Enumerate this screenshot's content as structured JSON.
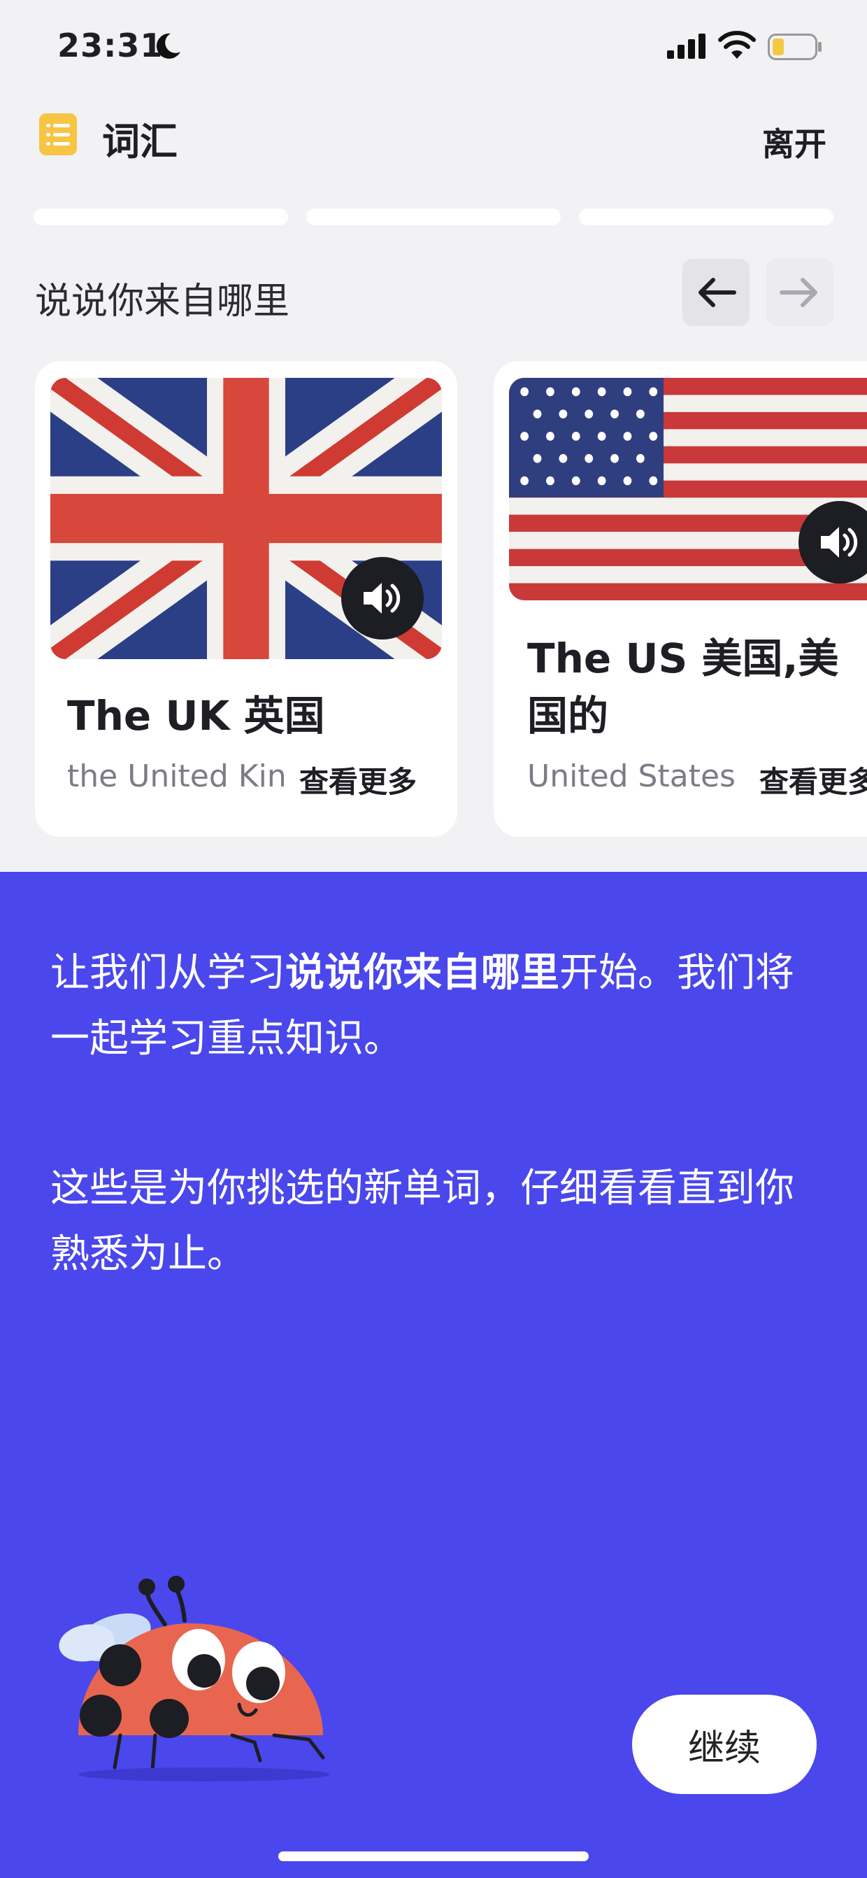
{
  "status_bar": {
    "time": "23:31"
  },
  "header": {
    "title": "词汇",
    "leave_label": "离开"
  },
  "progress": {
    "segments": 3,
    "completed": 0
  },
  "section": {
    "title": "说说你来自哪里"
  },
  "cards": [
    {
      "word": "The UK 英国",
      "subtitle": "the United Kin",
      "more_label": "查看更多",
      "flag": "uk-flag"
    },
    {
      "word": "The US 美国,美国的",
      "subtitle": "United States",
      "more_label": "查看更多",
      "flag": "us-flag"
    }
  ],
  "panel": {
    "para1_pre": "让我们从学习",
    "para1_bold": "说说你来自哪里",
    "para1_post": "开始。我们将一起学习重点知识。",
    "para2": "这些是为你挑选的新单词，仔细看看直到你熟悉为止。",
    "continue_label": "继续"
  },
  "colors": {
    "accent": "#4A47EC",
    "background": "#F2F2F5",
    "vocab_icon": "#F6C544",
    "speaker": "#1D1D24"
  }
}
